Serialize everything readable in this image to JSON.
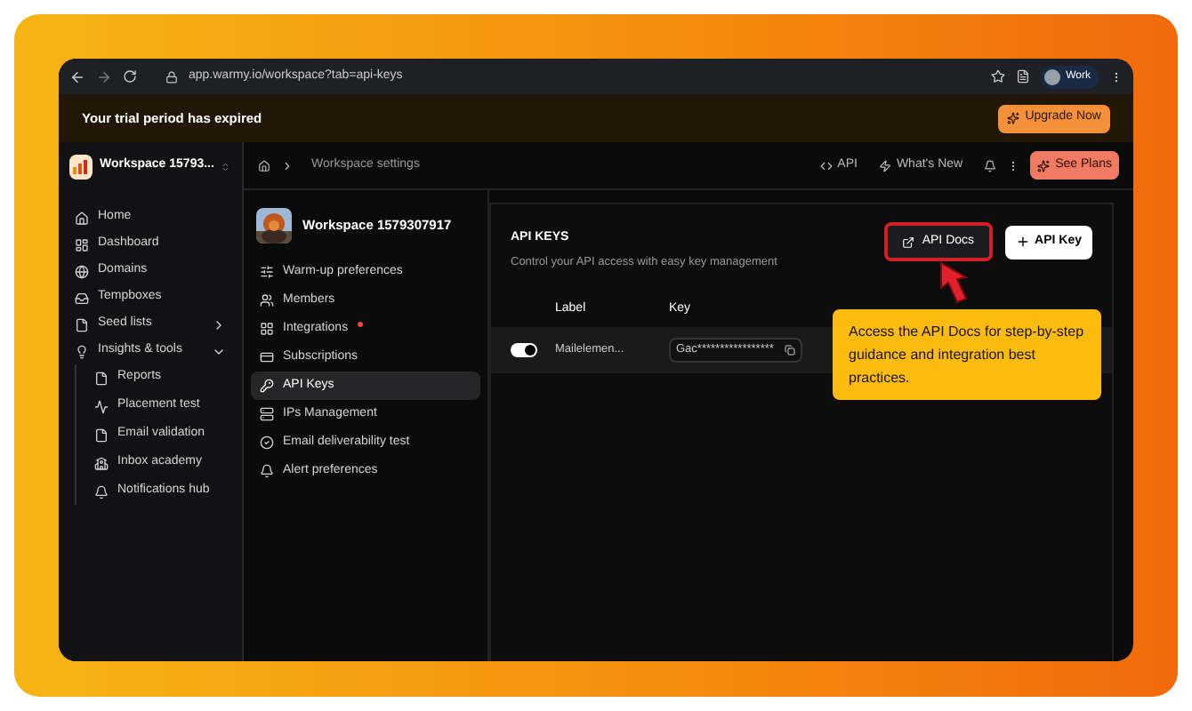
{
  "browser": {
    "url": "app.warmy.io/workspace?tab=api-keys",
    "profile": "Work"
  },
  "banner": {
    "message": "Your trial period has expired",
    "button": "Upgrade Now"
  },
  "header": {
    "workspace": "Workspace 15793...",
    "breadcrumb": "Workspace settings",
    "links": [
      "API",
      "What's New"
    ],
    "button": "See Plans"
  },
  "sidebar": {
    "items": [
      {
        "label": "Home",
        "selected": false
      },
      {
        "label": "Dashboard",
        "selected": false
      },
      {
        "label": "Domains",
        "selected": false
      },
      {
        "label": "Tempboxes",
        "selected": false
      },
      {
        "label": "Seed lists",
        "selected": false,
        "expanded": false
      },
      {
        "label": "Insights & tools",
        "selected": false,
        "expanded": true,
        "children": [
          {
            "label": "Reports",
            "selected": false
          },
          {
            "label": "Placement test",
            "selected": false
          },
          {
            "label": "Email validation",
            "selected": false
          },
          {
            "label": "Inbox academy",
            "selected": false
          },
          {
            "label": "Notifications hub",
            "selected": false
          }
        ]
      }
    ]
  },
  "settings_nav": {
    "workspace": "Workspace 1579307917",
    "items": [
      {
        "label": "Warm-up preferences",
        "selected": false,
        "badge": false
      },
      {
        "label": "Members",
        "selected": false,
        "badge": false
      },
      {
        "label": "Integrations",
        "selected": false,
        "badge": true
      },
      {
        "label": "Subscriptions",
        "selected": false,
        "badge": false
      },
      {
        "label": "API Keys",
        "selected": true,
        "badge": false
      },
      {
        "label": "IPs Management",
        "selected": false,
        "badge": false
      },
      {
        "label": "Email deliverability test",
        "selected": false,
        "badge": false
      },
      {
        "label": "Alert preferences",
        "selected": false,
        "badge": false
      }
    ]
  },
  "api_keys": {
    "title": "API KEYS",
    "subtitle": "Control your API access with easy key management",
    "docs_button": "API Docs",
    "add_button": "API Key",
    "columns": [
      "Label",
      "Key"
    ],
    "rows": [
      {
        "on": true,
        "label": "Mailelemen...",
        "key": "Gac*****************"
      }
    ]
  },
  "callout": {
    "text": "Access the API Docs for step-by-step guidance and integration best practices."
  }
}
